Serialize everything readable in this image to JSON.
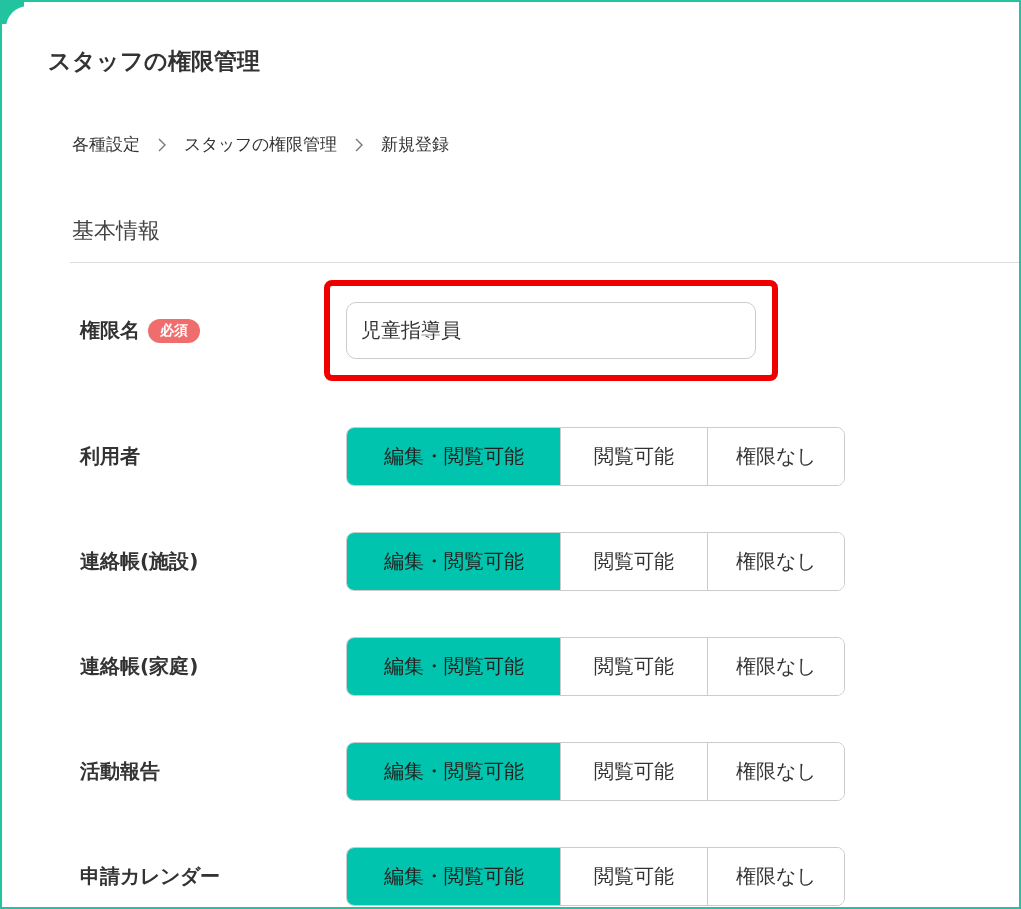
{
  "page": {
    "title": "スタッフの権限管理"
  },
  "breadcrumb": [
    {
      "label": "各種設定"
    },
    {
      "label": "スタッフの権限管理"
    },
    {
      "label": "新規登録"
    }
  ],
  "section": {
    "title": "基本情報"
  },
  "name_field": {
    "label": "権限名",
    "badge": "必須",
    "value": "児童指導員",
    "highlighted": true
  },
  "permissions": [
    {
      "label": "利用者",
      "options": [
        {
          "label": "編集・閲覧可能",
          "selected": true
        },
        {
          "label": "閲覧可能",
          "selected": false
        },
        {
          "label": "権限なし",
          "selected": false
        }
      ]
    },
    {
      "label": "連絡帳(施設)",
      "options": [
        {
          "label": "編集・閲覧可能",
          "selected": true
        },
        {
          "label": "閲覧可能",
          "selected": false
        },
        {
          "label": "権限なし",
          "selected": false
        }
      ]
    },
    {
      "label": "連絡帳(家庭)",
      "options": [
        {
          "label": "編集・閲覧可能",
          "selected": true
        },
        {
          "label": "閲覧可能",
          "selected": false
        },
        {
          "label": "権限なし",
          "selected": false
        }
      ]
    },
    {
      "label": "活動報告",
      "options": [
        {
          "label": "編集・閲覧可能",
          "selected": true
        },
        {
          "label": "閲覧可能",
          "selected": false
        },
        {
          "label": "権限なし",
          "selected": false
        }
      ]
    },
    {
      "label": "申請カレンダー",
      "options": [
        {
          "label": "編集・閲覧可能",
          "selected": true
        },
        {
          "label": "閲覧可能",
          "selected": false
        },
        {
          "label": "権限なし",
          "selected": false
        }
      ]
    }
  ]
}
